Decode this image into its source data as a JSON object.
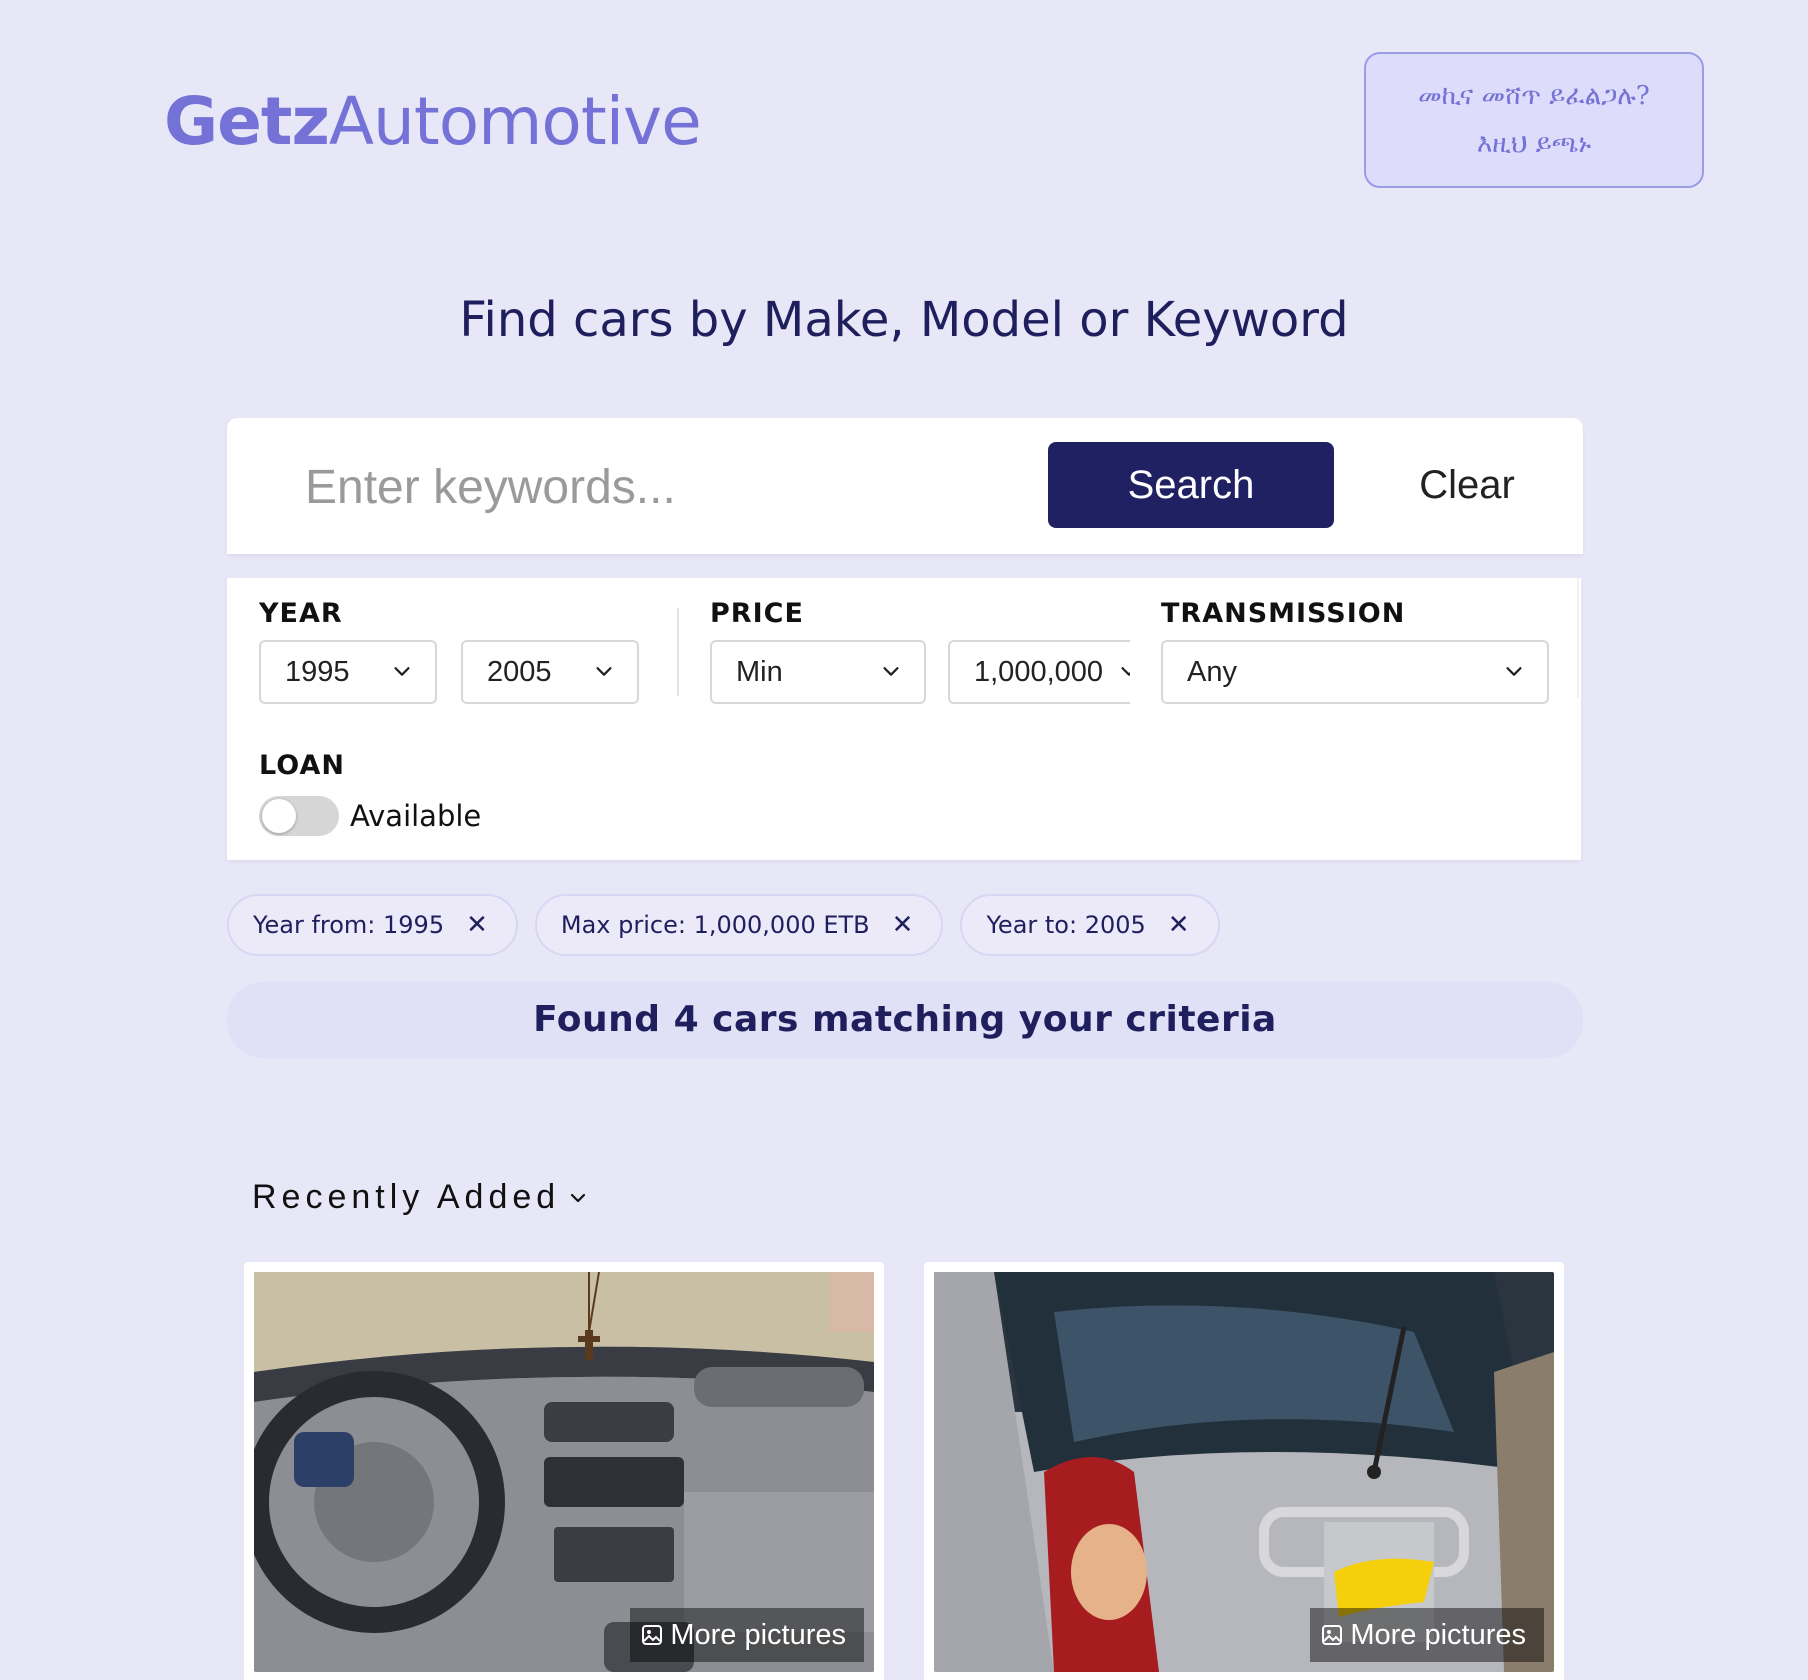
{
  "header": {
    "logo_bold": "Getz",
    "logo_thin": "Automotive",
    "cta_line1": "መኪና መሸጥ ይፈልጋሉ?",
    "cta_line2": "እዚህ ይጫኑ"
  },
  "headline": "Find cars by Make, Model or Keyword",
  "search": {
    "placeholder": "Enter keywords...",
    "value": "",
    "search_label": "Search",
    "clear_label": "Clear"
  },
  "filters": {
    "year_label": "YEAR",
    "year_from": "1995",
    "year_to": "2005",
    "price_label": "PRICE",
    "price_min": "Min",
    "price_max": "1,000,000",
    "transmission_label": "TRANSMISSION",
    "transmission": "Any",
    "loan_label": "LOAN",
    "loan_toggle_label": "Available",
    "loan_enabled": false
  },
  "active_filters": [
    {
      "label": "Year from: 1995",
      "remove": "✕"
    },
    {
      "label": "Max price: 1,000,000 ETB",
      "remove": "✕"
    },
    {
      "label": "Year to: 2005",
      "remove": "✕"
    }
  ],
  "results_text": "Found 4 cars matching your criteria",
  "sort_label": "Recently Added",
  "listings": [
    {
      "more_label": "More pictures",
      "image": "car-interior-dashboard"
    },
    {
      "more_label": "More pictures",
      "image": "silver-hatchback-rear"
    }
  ],
  "icons": {
    "chevron": "chevron-down-icon",
    "remove": "close-icon",
    "gallery": "image-icon"
  },
  "colors": {
    "background": "#e8e7f8",
    "brand": "#7472d6",
    "primary_dark": "#1f2163",
    "text_dark": "#1f1f5e"
  }
}
